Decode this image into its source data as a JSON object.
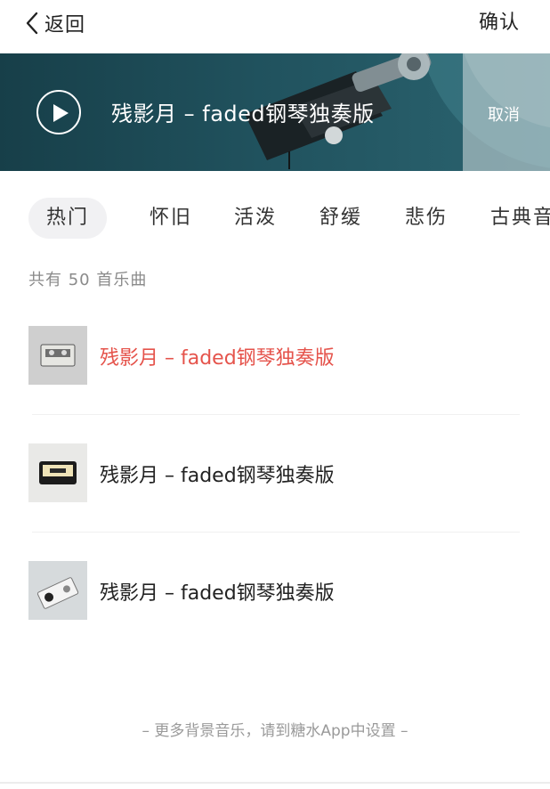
{
  "nav": {
    "back_label": "返回",
    "confirm_label": "确认"
  },
  "hero": {
    "title": "残影月 – faded钢琴独奏版",
    "cancel_label": "取消"
  },
  "tabs": [
    {
      "label": "热门",
      "active": true
    },
    {
      "label": "怀旧",
      "active": false
    },
    {
      "label": "活泼",
      "active": false
    },
    {
      "label": "舒缓",
      "active": false
    },
    {
      "label": "悲伤",
      "active": false
    },
    {
      "label": "古典音",
      "active": false
    }
  ],
  "count_text": "共有 50 首乐曲",
  "songs": [
    {
      "title": "残影月 – faded钢琴独奏版",
      "playing": true,
      "thumb_icon": "cassette-tape-icon"
    },
    {
      "title": "残影月 – faded钢琴独奏版",
      "playing": false,
      "thumb_icon": "cassette-tape-icon"
    },
    {
      "title": "残影月 – faded钢琴独奏版",
      "playing": false,
      "thumb_icon": "cassette-tape-icon"
    }
  ],
  "footer_note": "– 更多背景音乐，请到糖水App中设置 –",
  "colors": {
    "accent_playing": "#e5534b",
    "hero_bg": "#1d4a55"
  }
}
